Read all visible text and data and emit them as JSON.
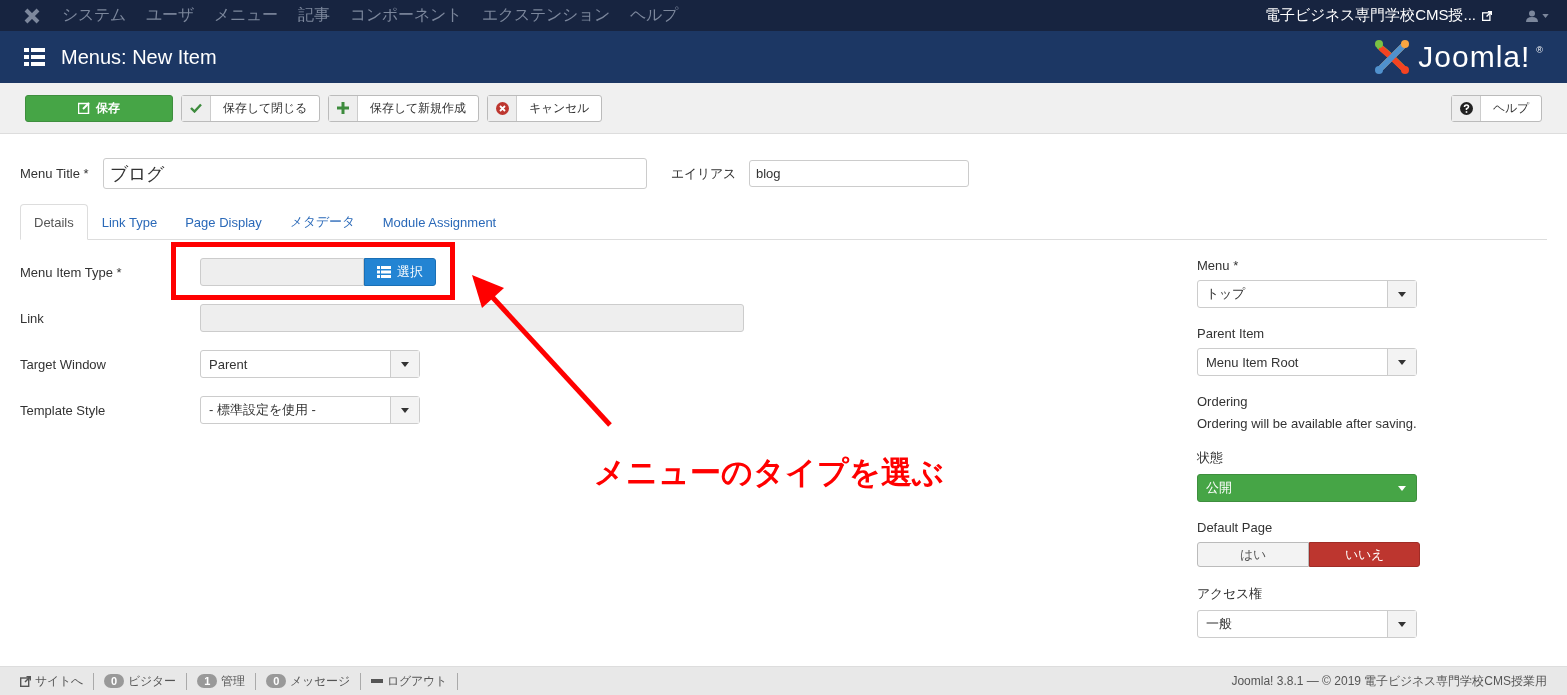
{
  "top_menu": {
    "items": [
      "システム",
      "ユーザ",
      "メニュー",
      "記事",
      "コンポーネント",
      "エクステンション",
      "ヘルプ"
    ],
    "site_link": "電子ビジネス専門学校CMS授..."
  },
  "header": {
    "title": "Menus: New Item",
    "logo_text": "Joomla!",
    "logo_mark": "®"
  },
  "toolbar": {
    "buttons": [
      {
        "label": "保存",
        "kind": "save"
      },
      {
        "label": "保存して閉じる",
        "kind": "check"
      },
      {
        "label": "保存して新規作成",
        "kind": "plus"
      },
      {
        "label": "キャンセル",
        "kind": "cancel"
      }
    ],
    "help": {
      "label": "ヘルプ"
    }
  },
  "title_row": {
    "title_label": "Menu Title *",
    "title_value": "ブログ",
    "alias_label": "エイリアス",
    "alias_value": "blog"
  },
  "tabs": [
    {
      "label": "Details",
      "selected": true
    },
    {
      "label": "Link Type",
      "selected": false
    },
    {
      "label": "Page Display",
      "selected": false
    },
    {
      "label": "メタデータ",
      "selected": false
    },
    {
      "label": "Module Assignment",
      "selected": false
    }
  ],
  "fields": [
    {
      "label": "Menu Item Type *",
      "kind": "picker",
      "button_label": "選択"
    },
    {
      "label": "Link",
      "kind": "readonly"
    },
    {
      "label": "Target Window",
      "kind": "select",
      "value": "Parent"
    },
    {
      "label": "Template Style",
      "kind": "select",
      "value": "- 標準設定を使用 -"
    }
  ],
  "sidebar": [
    {
      "kind": "select",
      "label": "Menu *",
      "value": "トップ"
    },
    {
      "kind": "select",
      "label": "Parent Item",
      "value": "Menu Item Root"
    },
    {
      "kind": "text",
      "label": "Ordering",
      "text": "Ordering will be available after saving."
    },
    {
      "kind": "status",
      "label": "状態",
      "value": "公開"
    },
    {
      "kind": "toggle",
      "label": "Default Page",
      "options": [
        {
          "label": "はい",
          "selected": false
        },
        {
          "label": "いいえ",
          "selected": true
        }
      ]
    },
    {
      "kind": "select",
      "label": "アクセス権",
      "value": "一般"
    }
  ],
  "annotation": {
    "text": "メニューのタイプを選ぶ"
  },
  "status_bar": {
    "items": [
      {
        "kind": "link",
        "label": "サイトへ"
      },
      {
        "kind": "count",
        "count": "0",
        "label": "ビジター"
      },
      {
        "kind": "count",
        "count": "1",
        "label": "管理"
      },
      {
        "kind": "count",
        "count": "0",
        "label": "メッセージ"
      },
      {
        "kind": "logout",
        "label": "ログアウト"
      }
    ],
    "footer": "Joomla! 3.8.1 — © 2019 電子ビジネス専門学校CMS授業用"
  }
}
